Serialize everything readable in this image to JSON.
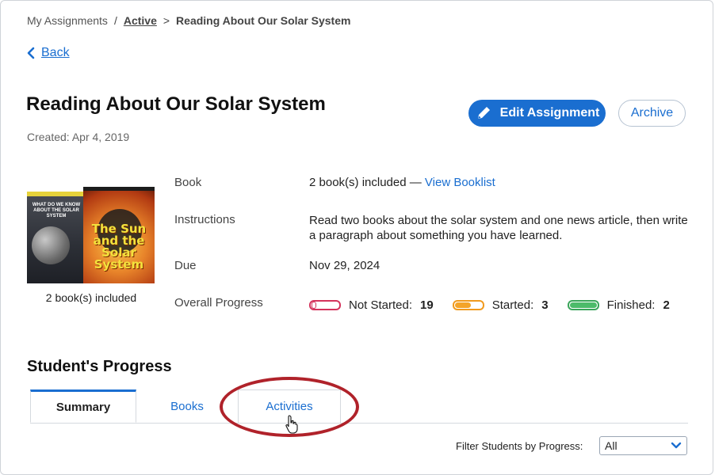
{
  "breadcrumb": {
    "root": "My Assignments",
    "sep1": "/",
    "active": "Active",
    "sep2": ">",
    "current": "Reading About Our Solar System"
  },
  "back_label": "Back",
  "assignment": {
    "title": "Reading About Our Solar System",
    "created": "Created: Apr 4, 2019"
  },
  "buttons": {
    "edit": "Edit Assignment",
    "archive": "Archive"
  },
  "covers": {
    "book1_text": "WHAT DO WE KNOW ABOUT THE SOLAR SYSTEM",
    "book2_text": "The Sun and the Solar System",
    "caption": "2 book(s) included"
  },
  "details": {
    "book_label": "Book",
    "book_value": "2 book(s) included —",
    "book_link": "View Booklist",
    "instructions_label": "Instructions",
    "instructions_value": "Read two books about the solar system and one news article, then write a paragraph about something you have learned.",
    "due_label": "Due",
    "due_value": "Nov 29, 2024",
    "progress_label": "Overall Progress"
  },
  "progress": {
    "not_started_label": "Not Started:",
    "not_started_count": "19",
    "started_label": "Started:",
    "started_count": "3",
    "finished_label": "Finished:",
    "finished_count": "2"
  },
  "students": {
    "section_title": "Student's Progress",
    "tabs": [
      "Summary",
      "Books",
      "Activities"
    ],
    "active_tab": "Summary",
    "filter_label": "Filter Students by Progress:",
    "filter_value": "All"
  },
  "colors": {
    "accent": "#1a6ed0",
    "not_started": "#d4345c",
    "started": "#f09a1e",
    "finished": "#3aa55a",
    "highlight": "#b0222a"
  }
}
